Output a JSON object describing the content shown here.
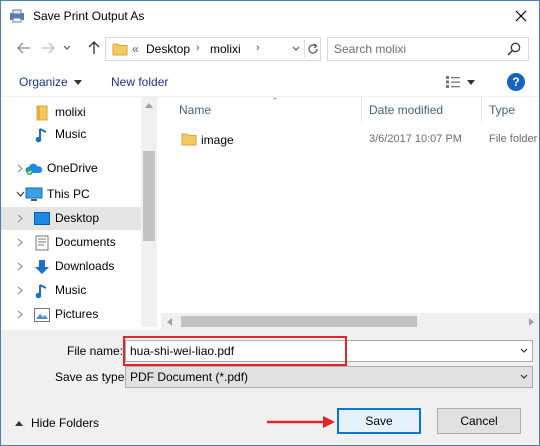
{
  "window": {
    "title": "Save Print Output As",
    "close_icon": "close-icon"
  },
  "address_bar": {
    "crumb_prefix": "«",
    "crumbs": [
      "Desktop",
      "molixi"
    ],
    "search_placeholder": "Search molixi"
  },
  "toolbar": {
    "organize_label": "Organize",
    "new_folder_label": "New folder",
    "help_label": "?"
  },
  "nav_pane": {
    "items": [
      {
        "label": "molixi",
        "icon": "folder-icon"
      },
      {
        "label": "Music",
        "icon": "music-icon"
      },
      {
        "label": "OneDrive",
        "icon": "onedrive-icon"
      },
      {
        "label": "This PC",
        "icon": "computer-icon"
      },
      {
        "label": "Desktop",
        "icon": "desktop-icon",
        "selected": true
      },
      {
        "label": "Documents",
        "icon": "documents-icon"
      },
      {
        "label": "Downloads",
        "icon": "downloads-icon"
      },
      {
        "label": "Music",
        "icon": "music-icon"
      },
      {
        "label": "Pictures",
        "icon": "pictures-icon"
      }
    ]
  },
  "file_list": {
    "columns": [
      "Name",
      "Date modified",
      "Type"
    ],
    "rows": [
      {
        "name": "image",
        "date": "3/6/2017 10:07 PM",
        "type": "File folder"
      }
    ]
  },
  "form": {
    "filename_label": "File name:",
    "filename_value": "hua-shi-wei-liao.pdf",
    "savetype_label": "Save as type:",
    "savetype_value": "PDF Document (*.pdf)"
  },
  "footer": {
    "hide_folders_label": "Hide Folders",
    "save_label": "Save",
    "cancel_label": "Cancel"
  },
  "colors": {
    "accent": "#0078d7",
    "highlight_red": "#e0262a",
    "link_blue": "#1e3287",
    "folder_yellow": "#f4c95d"
  }
}
